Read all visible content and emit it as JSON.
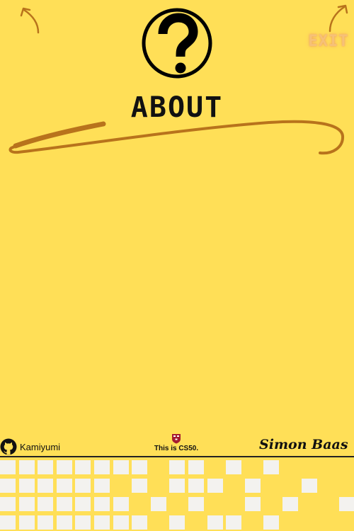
{
  "nav": {
    "exit_label": "EXIT"
  },
  "page": {
    "title": "ABOUT"
  },
  "footer": {
    "github_username": "Kamiyumi",
    "cs50_label": "This is CS50.",
    "signature": "Simon Baas ©"
  },
  "colors": {
    "background": "#ffdf57",
    "accent_brown": "#b8731c",
    "exit_glow": "#f6c178",
    "pixel": "#f3f2ef"
  },
  "icons": {
    "back": "curved-arrow-up-left-icon",
    "exit": "curved-arrow-up-right-icon",
    "help": "question-circle-icon",
    "github": "github-icon",
    "harvard": "harvard-shield-icon"
  }
}
